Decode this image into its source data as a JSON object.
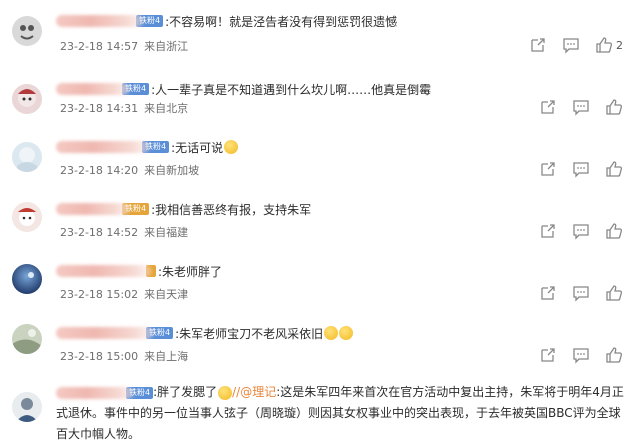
{
  "comments": [
    {
      "badge": "铁粉4",
      "text": ":不容易啊！就是泾告者没有得到惩罚很遗憾",
      "date": "23-2-18 14:57",
      "loc": "来自浙江",
      "likes": "2"
    },
    {
      "badge": "铁粉4",
      "text": ":人一辈子真是不知道遇到什么坎儿啊……他真是倒霉",
      "date": "23-2-18 14:31",
      "loc": "来自北京",
      "likes": ""
    },
    {
      "badge": "铁粉4",
      "text": ":无话可说",
      "date": "23-2-18 14:20",
      "loc": "来自新加坡",
      "likes": ""
    },
    {
      "badge": "铁粉4",
      "text": ":我相信善恶终有报，支持朱军",
      "date": "23-2-18 14:52",
      "loc": "来自福建",
      "likes": ""
    },
    {
      "badge": "",
      "text": ":朱老师胖了",
      "date": "23-2-18 15:02",
      "loc": "来自天津",
      "likes": ""
    },
    {
      "badge": "铁粉4",
      "text": ":朱军老师宝刀不老风采依旧",
      "date": "23-2-18 15:00",
      "loc": "来自上海",
      "likes": ""
    }
  ],
  "last_comment": {
    "badge": "铁粉4",
    "text_a": ":胖了发腮了",
    "mention": "//@理记",
    "text_b": ":这是朱军四年来首次在官方活动中复出主持，朱军将于明年4月正式退休。事件中的另一位当事人弦子（周晓璇）则因其女权事业中的突出表现，于去年被英国BBC评为全球百大巾帼人物。"
  }
}
